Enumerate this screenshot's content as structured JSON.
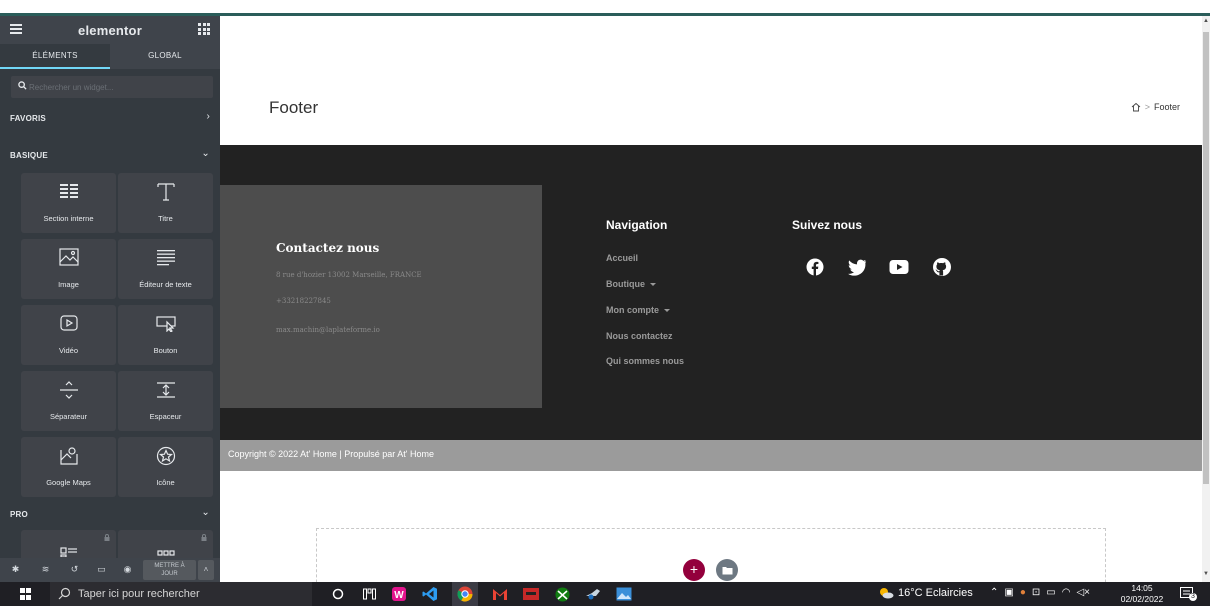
{
  "sidebar": {
    "logo": "elementor",
    "tabs": [
      {
        "label": "ÉLÉMENTS"
      },
      {
        "label": "GLOBAL"
      }
    ],
    "search_placeholder": "Rechercher un widget...",
    "sections": {
      "favorites": "FAVORIS",
      "basic": "BASIQUE",
      "pro": "PRO"
    },
    "widgets": [
      {
        "label": "Section interne",
        "icon": "inner-section-icon"
      },
      {
        "label": "Titre",
        "icon": "heading-icon"
      },
      {
        "label": "Image",
        "icon": "image-icon"
      },
      {
        "label": "Éditeur de texte",
        "icon": "text-editor-icon"
      },
      {
        "label": "Vidéo",
        "icon": "video-icon"
      },
      {
        "label": "Bouton",
        "icon": "button-icon"
      },
      {
        "label": "Séparateur",
        "icon": "divider-icon"
      },
      {
        "label": "Espaceur",
        "icon": "spacer-icon"
      },
      {
        "label": "Google Maps",
        "icon": "google-maps-icon"
      },
      {
        "label": "Icône",
        "icon": "star-icon"
      }
    ],
    "footer": {
      "publish_line1": "METTRE À",
      "publish_line2": "JOUR"
    }
  },
  "canvas": {
    "page_title": "Footer",
    "breadcrumb_current": "Footer",
    "contact": {
      "title": "Contactez nous",
      "address": "8 rue d'hozier 13002 Marseille, FRANCE",
      "phone": "+33218227845",
      "email": "max.machin@laplateforme.io"
    },
    "navigation": {
      "title": "Navigation",
      "items": [
        {
          "label": "Accueil"
        },
        {
          "label": "Boutique"
        },
        {
          "label": "Mon compte"
        },
        {
          "label": "Nous contactez"
        },
        {
          "label": "Qui sommes nous"
        }
      ]
    },
    "follow": {
      "title": "Suivez nous",
      "icons": [
        "facebook-icon",
        "twitter-icon",
        "youtube-icon",
        "github-icon"
      ]
    },
    "copyright": "Copyright © 2022 At' Home | Propulsé par At' Home"
  },
  "taskbar": {
    "search_text": "Taper ici pour rechercher",
    "weather": "16°C  Eclaircies",
    "time": "14:05",
    "date": "02/02/2022",
    "notifications": "3"
  },
  "colors": {
    "sidebar_bg": "#343a40",
    "footer_dark": "#222222",
    "contact_box": "#4d4d4d",
    "copyright_bar": "#9b9b9b",
    "add_button": "#93003c",
    "accent_tab": "#71d7f7"
  }
}
